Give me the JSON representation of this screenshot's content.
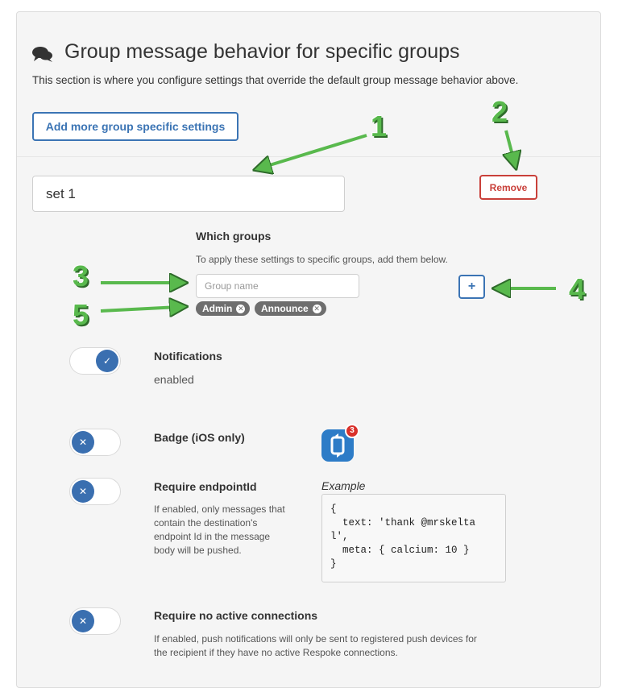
{
  "section": {
    "icon": "comments-icon",
    "title": "Group message behavior for specific groups",
    "subtitle": "This section is where you configure settings that override the default group message behavior above."
  },
  "add_button_label": "Add more group specific settings",
  "set": {
    "name_value": "set 1",
    "remove_label": "Remove"
  },
  "groups": {
    "heading": "Which groups",
    "help": "To apply these settings to specific groups, add them below.",
    "input_placeholder": "Group name",
    "add_label": "+",
    "tags": [
      "Admin",
      "Announce"
    ],
    "tag_remove_glyph": "✕"
  },
  "settings": {
    "notifications": {
      "title": "Notifications",
      "status": "enabled",
      "enabled": true,
      "knob_icon": "check-icon",
      "knob_glyph": "✓"
    },
    "badge": {
      "title": "Badge (iOS only)",
      "enabled": false,
      "knob_icon": "close-icon",
      "knob_glyph": "✕",
      "badge_count": "3"
    },
    "endpoint": {
      "title": "Require endpointId",
      "enabled": false,
      "knob_glyph": "✕",
      "description_lines": [
        "If enabled, only messages that",
        "contain the destination's",
        "endpoint Id in the message",
        "body will be pushed."
      ],
      "example_label": "Example",
      "example_code": "{\n  text: 'thank @mrskelta\nl',\n  meta: { calcium: 10 }\n}"
    },
    "no_connections": {
      "title": "Require no active connections",
      "enabled": false,
      "knob_glyph": "✕",
      "description_lines": [
        "If enabled, push notifications will only be sent to registered push devices for",
        "the recipient if they have no active Respoke connections."
      ]
    }
  },
  "callouts": [
    "1",
    "2",
    "3",
    "4",
    "5"
  ],
  "colors": {
    "accent": "#3b74b4",
    "danger": "#c9403a",
    "callout": "#59b94d",
    "tag": "#6e6e6e"
  }
}
